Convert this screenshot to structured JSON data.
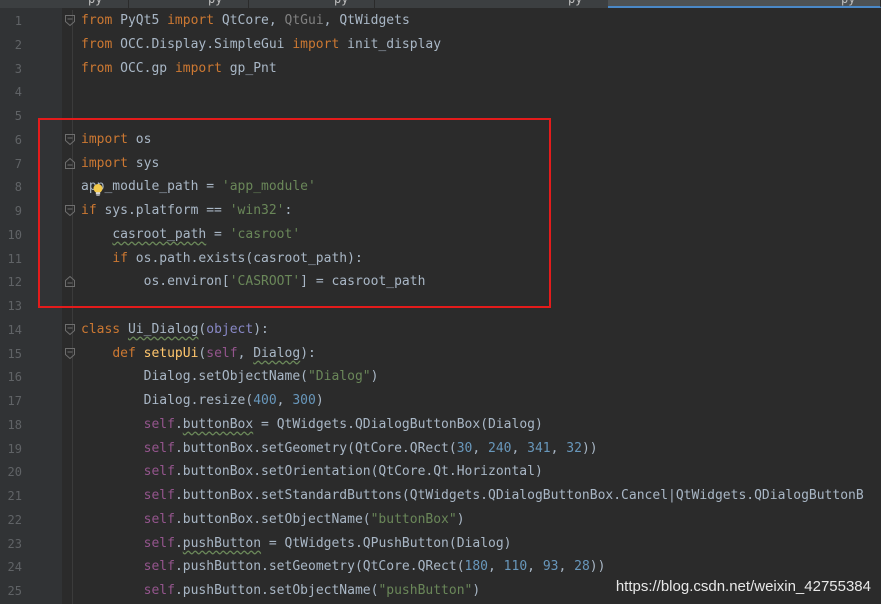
{
  "tabs": [
    {
      "label": "py",
      "active": false
    },
    {
      "label": "py",
      "active": false
    },
    {
      "label": "py",
      "active": false
    },
    {
      "label": "py",
      "active": false
    },
    {
      "label": "py",
      "active": true
    }
  ],
  "lines": [
    {
      "num": "1",
      "fold": "open",
      "tokens": [
        [
          "kw",
          "from "
        ],
        [
          "id",
          "PyQt5 "
        ],
        [
          "kw",
          "import "
        ],
        [
          "id",
          "QtCore, "
        ],
        [
          "grey",
          "QtGui"
        ],
        [
          "id",
          ", QtWidgets"
        ]
      ]
    },
    {
      "num": "2",
      "fold": "",
      "tokens": [
        [
          "kw",
          "from "
        ],
        [
          "id",
          "OCC.Display.SimpleGui "
        ],
        [
          "kw",
          "import "
        ],
        [
          "id",
          "init_display"
        ]
      ]
    },
    {
      "num": "3",
      "fold": "",
      "tokens": [
        [
          "kw",
          "from "
        ],
        [
          "id",
          "OCC.gp "
        ],
        [
          "kw",
          "import "
        ],
        [
          "id",
          "gp_Pnt"
        ]
      ]
    },
    {
      "num": "4",
      "fold": "",
      "tokens": []
    },
    {
      "num": "5",
      "fold": "",
      "tokens": []
    },
    {
      "num": "6",
      "fold": "open",
      "tokens": [
        [
          "kw",
          "import "
        ],
        [
          "id",
          "os"
        ]
      ]
    },
    {
      "num": "7",
      "fold": "close",
      "tokens": [
        [
          "kw",
          "import "
        ],
        [
          "id",
          "sys"
        ]
      ]
    },
    {
      "num": "8",
      "fold": "",
      "tokens": [
        [
          "id",
          "app_module_path = "
        ],
        [
          "str",
          "'app_module'"
        ]
      ]
    },
    {
      "num": "9",
      "fold": "open",
      "tokens": [
        [
          "kw",
          "if "
        ],
        [
          "id",
          "sys.platform == "
        ],
        [
          "str",
          "'win32'"
        ],
        [
          "id",
          ":"
        ]
      ]
    },
    {
      "num": "10",
      "fold": "",
      "tokens": [
        [
          "id",
          "    "
        ],
        [
          "un",
          "casroot_path"
        ],
        [
          "id",
          " = "
        ],
        [
          "str",
          "'casroot'"
        ]
      ]
    },
    {
      "num": "11",
      "fold": "",
      "tokens": [
        [
          "id",
          "    "
        ],
        [
          "kw",
          "if "
        ],
        [
          "id",
          "os.path.exists(casroot_path):"
        ]
      ]
    },
    {
      "num": "12",
      "fold": "close",
      "tokens": [
        [
          "id",
          "        os.environ["
        ],
        [
          "str",
          "'CASROOT'"
        ],
        [
          "id",
          "] = casroot_path"
        ]
      ]
    },
    {
      "num": "13",
      "fold": "",
      "tokens": []
    },
    {
      "num": "14",
      "fold": "open",
      "tokens": [
        [
          "kw",
          "class "
        ],
        [
          "un",
          "Ui_Dialog"
        ],
        [
          "id",
          "("
        ],
        [
          "builtin",
          "object"
        ],
        [
          "id",
          "):"
        ]
      ]
    },
    {
      "num": "15",
      "fold": "open",
      "tokens": [
        [
          "id",
          "    "
        ],
        [
          "kw",
          "def "
        ],
        [
          "fn",
          "setupUi"
        ],
        [
          "id",
          "("
        ],
        [
          "self",
          "self"
        ],
        [
          "id",
          ", "
        ],
        [
          "un",
          "Dialog"
        ],
        [
          "id",
          "):"
        ]
      ]
    },
    {
      "num": "16",
      "fold": "",
      "tokens": [
        [
          "id",
          "        Dialog.setObjectName("
        ],
        [
          "str",
          "\"Dialog\""
        ],
        [
          "id",
          ")"
        ]
      ]
    },
    {
      "num": "17",
      "fold": "",
      "tokens": [
        [
          "id",
          "        Dialog.resize("
        ],
        [
          "num",
          "400"
        ],
        [
          "id",
          ", "
        ],
        [
          "num",
          "300"
        ],
        [
          "id",
          ")"
        ]
      ]
    },
    {
      "num": "18",
      "fold": "",
      "tokens": [
        [
          "id",
          "        "
        ],
        [
          "self",
          "self"
        ],
        [
          "id",
          "."
        ],
        [
          "un",
          "buttonBox"
        ],
        [
          "id",
          " = QtWidgets.QDialogButtonBox(Dialog)"
        ]
      ]
    },
    {
      "num": "19",
      "fold": "",
      "tokens": [
        [
          "id",
          "        "
        ],
        [
          "self",
          "self"
        ],
        [
          "id",
          ".buttonBox.setGeometry(QtCore.QRect("
        ],
        [
          "num",
          "30"
        ],
        [
          "id",
          ", "
        ],
        [
          "num",
          "240"
        ],
        [
          "id",
          ", "
        ],
        [
          "num",
          "341"
        ],
        [
          "id",
          ", "
        ],
        [
          "num",
          "32"
        ],
        [
          "id",
          "))"
        ]
      ]
    },
    {
      "num": "20",
      "fold": "",
      "tokens": [
        [
          "id",
          "        "
        ],
        [
          "self",
          "self"
        ],
        [
          "id",
          ".buttonBox.setOrientation(QtCore.Qt.Horizontal)"
        ]
      ]
    },
    {
      "num": "21",
      "fold": "",
      "tokens": [
        [
          "id",
          "        "
        ],
        [
          "self",
          "self"
        ],
        [
          "id",
          ".buttonBox.setStandardButtons(QtWidgets.QDialogButtonBox.Cancel|QtWidgets.QDialogButtonB"
        ]
      ]
    },
    {
      "num": "22",
      "fold": "",
      "tokens": [
        [
          "id",
          "        "
        ],
        [
          "self",
          "self"
        ],
        [
          "id",
          ".buttonBox.setObjectName("
        ],
        [
          "str",
          "\"buttonBox\""
        ],
        [
          "id",
          ")"
        ]
      ]
    },
    {
      "num": "23",
      "fold": "",
      "tokens": [
        [
          "id",
          "        "
        ],
        [
          "self",
          "self"
        ],
        [
          "id",
          "."
        ],
        [
          "un",
          "pushButton"
        ],
        [
          "id",
          " = QtWidgets.QPushButton(Dialog)"
        ]
      ]
    },
    {
      "num": "24",
      "fold": "",
      "tokens": [
        [
          "id",
          "        "
        ],
        [
          "self",
          "self"
        ],
        [
          "id",
          ".pushButton.setGeometry(QtCore.QRect("
        ],
        [
          "num",
          "180"
        ],
        [
          "id",
          ", "
        ],
        [
          "num",
          "110"
        ],
        [
          "id",
          ", "
        ],
        [
          "num",
          "93"
        ],
        [
          "id",
          ", "
        ],
        [
          "num",
          "28"
        ],
        [
          "id",
          "))"
        ]
      ]
    },
    {
      "num": "25",
      "fold": "",
      "tokens": [
        [
          "id",
          "        "
        ],
        [
          "self",
          "self"
        ],
        [
          "id",
          ".pushButton.setObjectName("
        ],
        [
          "str",
          "\"pushButton\""
        ],
        [
          "id",
          ")"
        ]
      ]
    }
  ],
  "watermark": "https://blog.csdn.net/weixin_42755384",
  "colors": {
    "background": "#2b2b2b",
    "gutter": "#313335",
    "keyword": "#cc7832",
    "string": "#6a8759",
    "number": "#6897bb",
    "self": "#94558d",
    "function": "#ffc66d",
    "highlight_box": "#e41b1b"
  }
}
